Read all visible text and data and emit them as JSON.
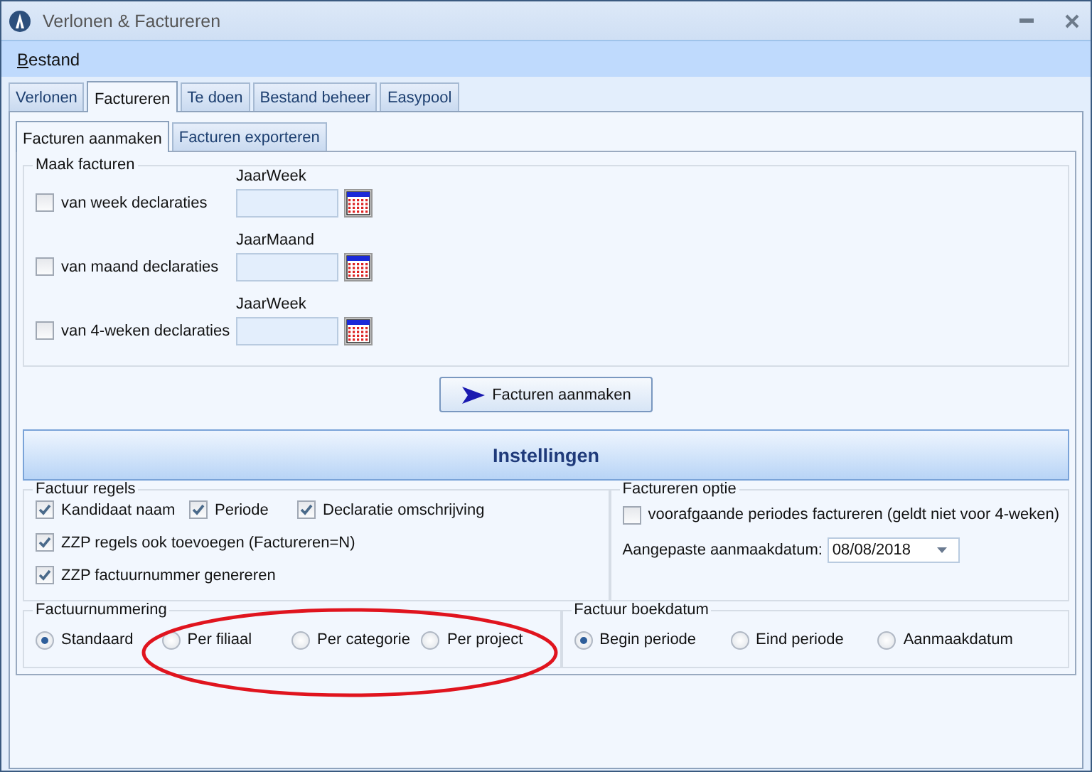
{
  "window": {
    "title": "Verlonen & Factureren"
  },
  "menu": [
    "Bestand"
  ],
  "tabs": [
    {
      "label": "Verlonen",
      "selected": false
    },
    {
      "label": "Factureren",
      "selected": true
    },
    {
      "label": "Te doen",
      "selected": false
    },
    {
      "label": "Bestand beheer",
      "selected": false
    },
    {
      "label": "Easypool",
      "selected": false
    }
  ],
  "subtabs": [
    {
      "label": "Facturen aanmaken",
      "selected": true
    },
    {
      "label": "Facturen exporteren",
      "selected": false
    }
  ],
  "maak_facturen": {
    "title": "Maak facturen",
    "rows": [
      {
        "label": "van week declaraties",
        "checked": false,
        "field_label": "JaarWeek"
      },
      {
        "label": "van maand declaraties",
        "checked": false,
        "field_label": "JaarMaand"
      },
      {
        "label": "van 4-weken declaraties",
        "checked": false,
        "field_label": "JaarWeek"
      }
    ]
  },
  "create_button": "Facturen aanmaken",
  "settings_header": "Instellingen",
  "factuur_regels": {
    "title": "Factuur regels",
    "options": [
      {
        "label": "Kandidaat naam",
        "checked": true
      },
      {
        "label": "Periode",
        "checked": true
      },
      {
        "label": "Declaratie omschrijving",
        "checked": true
      },
      {
        "label": "ZZP regels ook toevoegen (Factureren=N)",
        "checked": true
      },
      {
        "label": "ZZP factuurnummer genereren",
        "checked": true
      }
    ]
  },
  "factureren_optie": {
    "title": "Factureren optie",
    "option": {
      "label": "voorafgaande periodes factureren (geldt niet voor 4-weken)",
      "checked": false
    },
    "date_label": "Aangepaste aanmaakdatum:",
    "date_value": "08/08/2018"
  },
  "factuurnummering": {
    "title": "Factuurnummering",
    "options": [
      {
        "label": "Standaard",
        "selected": true
      },
      {
        "label": "Per filiaal",
        "selected": false
      },
      {
        "label": "Per categorie",
        "selected": false
      },
      {
        "label": "Per project",
        "selected": false
      }
    ]
  },
  "factuur_boekdatum": {
    "title": "Factuur boekdatum",
    "options": [
      {
        "label": "Begin periode",
        "selected": true
      },
      {
        "label": "Eind periode",
        "selected": false
      },
      {
        "label": "Aanmaakdatum",
        "selected": false
      }
    ]
  }
}
